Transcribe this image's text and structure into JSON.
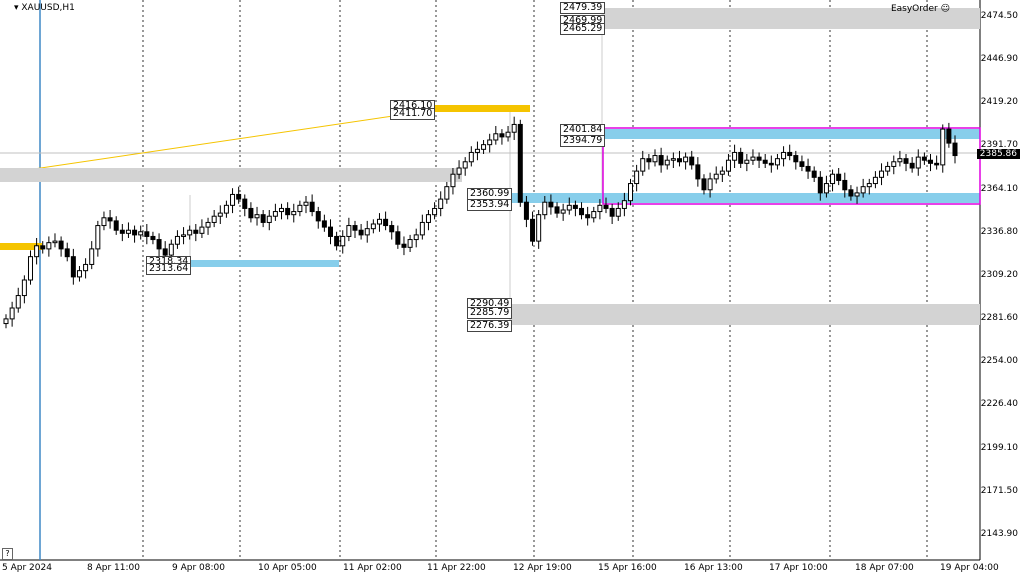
{
  "header": {
    "symbol": "XAUUSD,H1",
    "indicator": "EasyOrder"
  },
  "current_price": "2385.86",
  "y_axis_labels": [
    "2474.50",
    "2446.90",
    "2419.20",
    "2391.70",
    "2364.10",
    "2336.80",
    "2309.20",
    "2281.60",
    "2254.00",
    "2226.40",
    "2199.10",
    "2171.50",
    "2143.90"
  ],
  "x_axis_labels": [
    "5 Apr 2024",
    "8 Apr 11:00",
    "9 Apr 08:00",
    "10 Apr 05:00",
    "11 Apr 02:00",
    "11 Apr 22:00",
    "12 Apr 19:00",
    "15 Apr 16:00",
    "16 Apr 13:00",
    "17 Apr 10:00",
    "18 Apr 07:00",
    "19 Apr 04:00"
  ],
  "zone_labels": {
    "z_2479": "2479.39",
    "z_2469": "2469.99",
    "z_2465": "2465.29",
    "z_2416": "2416.10",
    "z_2411": "2411.70",
    "z_2401": "2401.84",
    "z_2394": "2394.79",
    "z_2360": "2360.99",
    "z_2353": "2353.94",
    "z_2318": "2318.34",
    "z_2313": "2313.64",
    "z_2290": "2290.49",
    "z_2285": "2285.79",
    "z_2276": "2276.39"
  },
  "help_icon": "?",
  "colors": {
    "grey_zone": "#d3d3d3",
    "gold_zone": "#f5c400",
    "blue_zone": "#87ceeb",
    "range_box": "#e000e0",
    "vline": "#3f88c5"
  },
  "chart_data": {
    "type": "candlestick",
    "ylim": [
      2130,
      2490
    ],
    "closes": [
      2285,
      2292,
      2300,
      2310,
      2325,
      2332,
      2330,
      2334,
      2335,
      2330,
      2325,
      2312,
      2316,
      2320,
      2330,
      2345,
      2350,
      2348,
      2342,
      2340,
      2342,
      2339,
      2341,
      2338,
      2336,
      2330,
      2326,
      2333,
      2338,
      2339,
      2342,
      2340,
      2344,
      2347,
      2351,
      2353,
      2358,
      2365,
      2362,
      2356,
      2350,
      2352,
      2347,
      2351,
      2354,
      2356,
      2352,
      2354,
      2358,
      2360,
      2354,
      2348,
      2344,
      2338,
      2332,
      2338,
      2345,
      2342,
      2339,
      2343,
      2346,
      2349,
      2345,
      2341,
      2333,
      2331,
      2336,
      2339,
      2347,
      2352,
      2356,
      2362,
      2370,
      2378,
      2382,
      2386,
      2392,
      2394,
      2397,
      2400,
      2404,
      2402,
      2405,
      2410,
      2360,
      2349,
      2335,
      2352,
      2360,
      2357,
      2353,
      2355,
      2358,
      2356,
      2352,
      2350,
      2354,
      2358,
      2356,
      2351,
      2356,
      2361,
      2372,
      2380,
      2388,
      2386,
      2390,
      2384,
      2387,
      2388,
      2386,
      2389,
      2384,
      2375,
      2368,
      2375,
      2378,
      2380,
      2387,
      2392,
      2385,
      2387,
      2389,
      2387,
      2385,
      2384,
      2388,
      2392,
      2390,
      2386,
      2383,
      2380,
      2376,
      2366,
      2372,
      2378,
      2374,
      2368,
      2364,
      2366,
      2370,
      2372,
      2376,
      2380,
      2383,
      2386,
      2388,
      2385,
      2382,
      2389,
      2387,
      2385,
      2384,
      2407,
      2398,
      2390
    ]
  }
}
